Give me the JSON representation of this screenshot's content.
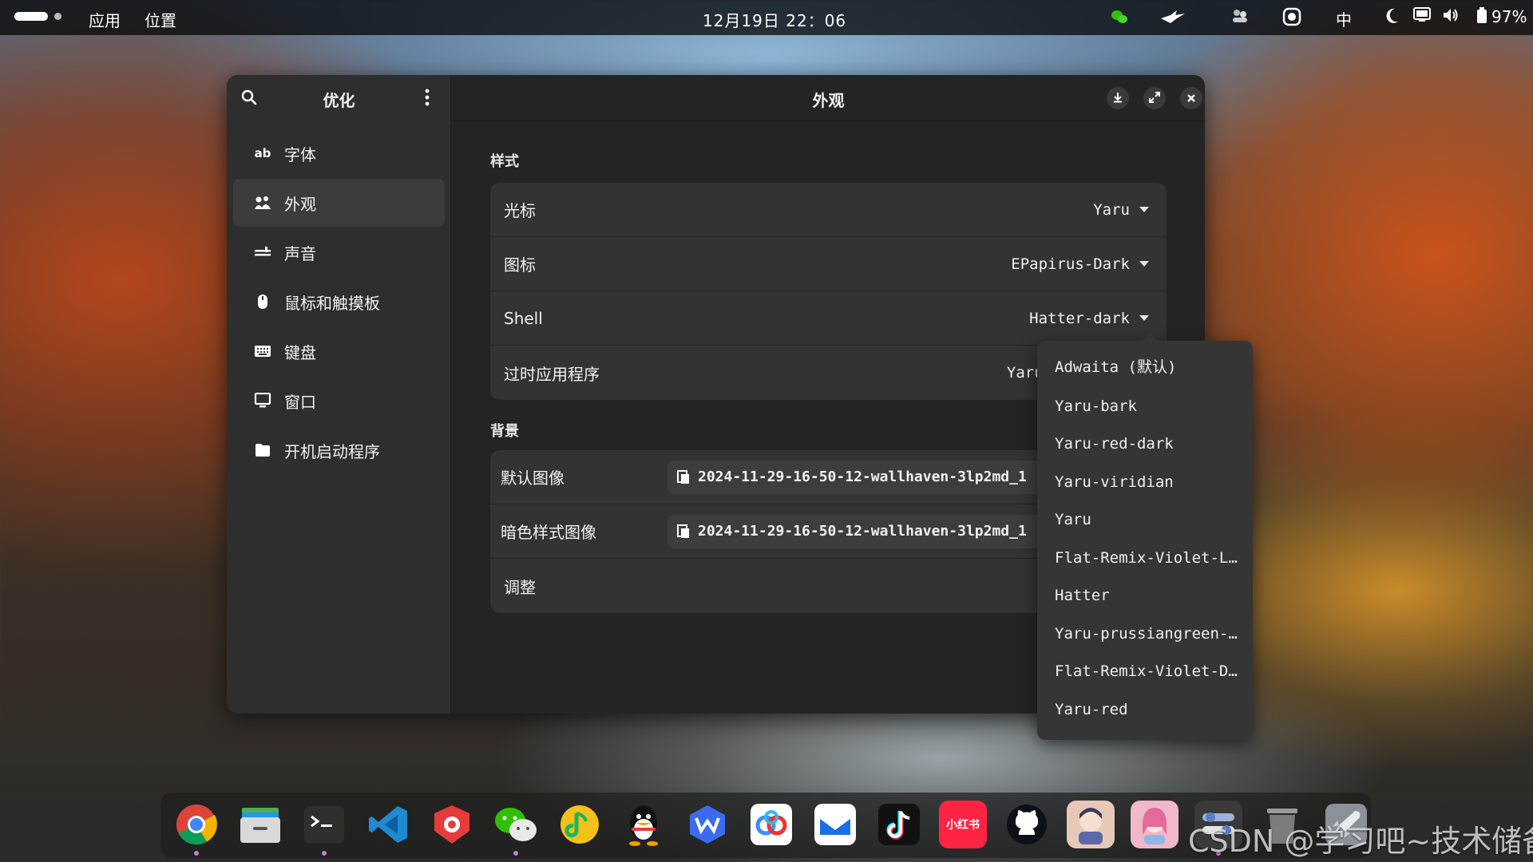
{
  "topbar": {
    "apps_label": "应用",
    "places_label": "位置",
    "clock": "12月19日 22：06",
    "input_method": "中",
    "battery": "97%"
  },
  "window": {
    "sidebar": {
      "title": "优化",
      "items": [
        {
          "label": "字体",
          "icon": "font-icon"
        },
        {
          "label": "外观",
          "icon": "appearance-icon",
          "active": true
        },
        {
          "label": "声音",
          "icon": "sound-icon"
        },
        {
          "label": "鼠标和触摸板",
          "icon": "mouse-icon"
        },
        {
          "label": "键盘",
          "icon": "keyboard-icon"
        },
        {
          "label": "窗口",
          "icon": "window-icon"
        },
        {
          "label": "开机启动程序",
          "icon": "folder-icon"
        }
      ]
    },
    "content": {
      "title": "外观",
      "styles_section": {
        "title": "样式",
        "rows": [
          {
            "label": "光标",
            "value": "Yaru"
          },
          {
            "label": "图标",
            "value": "EPapirus-Dark"
          },
          {
            "label": "Shell",
            "value": "Hatter-dark"
          },
          {
            "label": "过时应用程序",
            "value": "Yaru-ma"
          }
        ]
      },
      "background_section": {
        "title": "背景",
        "rows": [
          {
            "label": "默认图像",
            "file": "2024-11-29-16-50-12-wallhaven-3lp2md_1"
          },
          {
            "label": "暗色样式图像",
            "file": "2024-11-29-16-50-12-wallhaven-3lp2md_1"
          },
          {
            "label": "调整",
            "file": ""
          }
        ]
      }
    }
  },
  "shell_dropdown": {
    "options": [
      "Adwaita (默认)",
      "Yaru-bark",
      "Yaru-red-dark",
      "Yaru-viridian",
      "Yaru",
      "Flat-Remix-Violet-L...",
      "Hatter",
      "Yaru-prussiangreen-...",
      "Flat-Remix-Violet-D...",
      "Yaru-red"
    ]
  },
  "dock": {
    "apps": [
      {
        "name": "chrome-icon",
        "color": "#ffffff"
      },
      {
        "name": "files-icon",
        "color": "#d0d0d0"
      },
      {
        "name": "terminal-icon",
        "color": "#2b2b2b"
      },
      {
        "name": "vscode-icon",
        "color": "#1f8ad2"
      },
      {
        "name": "red-app-icon",
        "color": "#e53b3b"
      },
      {
        "name": "wechat-icon",
        "color": "#2dc100"
      },
      {
        "name": "music-icon",
        "color": "#f3c11a"
      },
      {
        "name": "qq-icon",
        "color": "#111111"
      },
      {
        "name": "wps-icon",
        "color": "#3b6cf0"
      },
      {
        "name": "baidu-netdisk-icon",
        "color": "#ffffff"
      },
      {
        "name": "mail-icon",
        "color": "#1d6fe8"
      },
      {
        "name": "tiktok-icon",
        "color": "#111111"
      },
      {
        "name": "xiaohongshu-icon",
        "color": "#ff2442",
        "label": "小红书"
      },
      {
        "name": "github-icon",
        "color": "#0d1117"
      },
      {
        "name": "anime-app-icon-1",
        "color": "#e8c9b8"
      },
      {
        "name": "anime-app-icon-2",
        "color": "#f0b8c8"
      },
      {
        "name": "tweaks-icon",
        "color": "#9aa4b2"
      },
      {
        "name": "trash-icon",
        "color": "#8a8a8a"
      },
      {
        "name": "rocket-icon",
        "color": "#b0b4ba"
      }
    ]
  },
  "watermark": "CSDN @学习吧~技术储备"
}
